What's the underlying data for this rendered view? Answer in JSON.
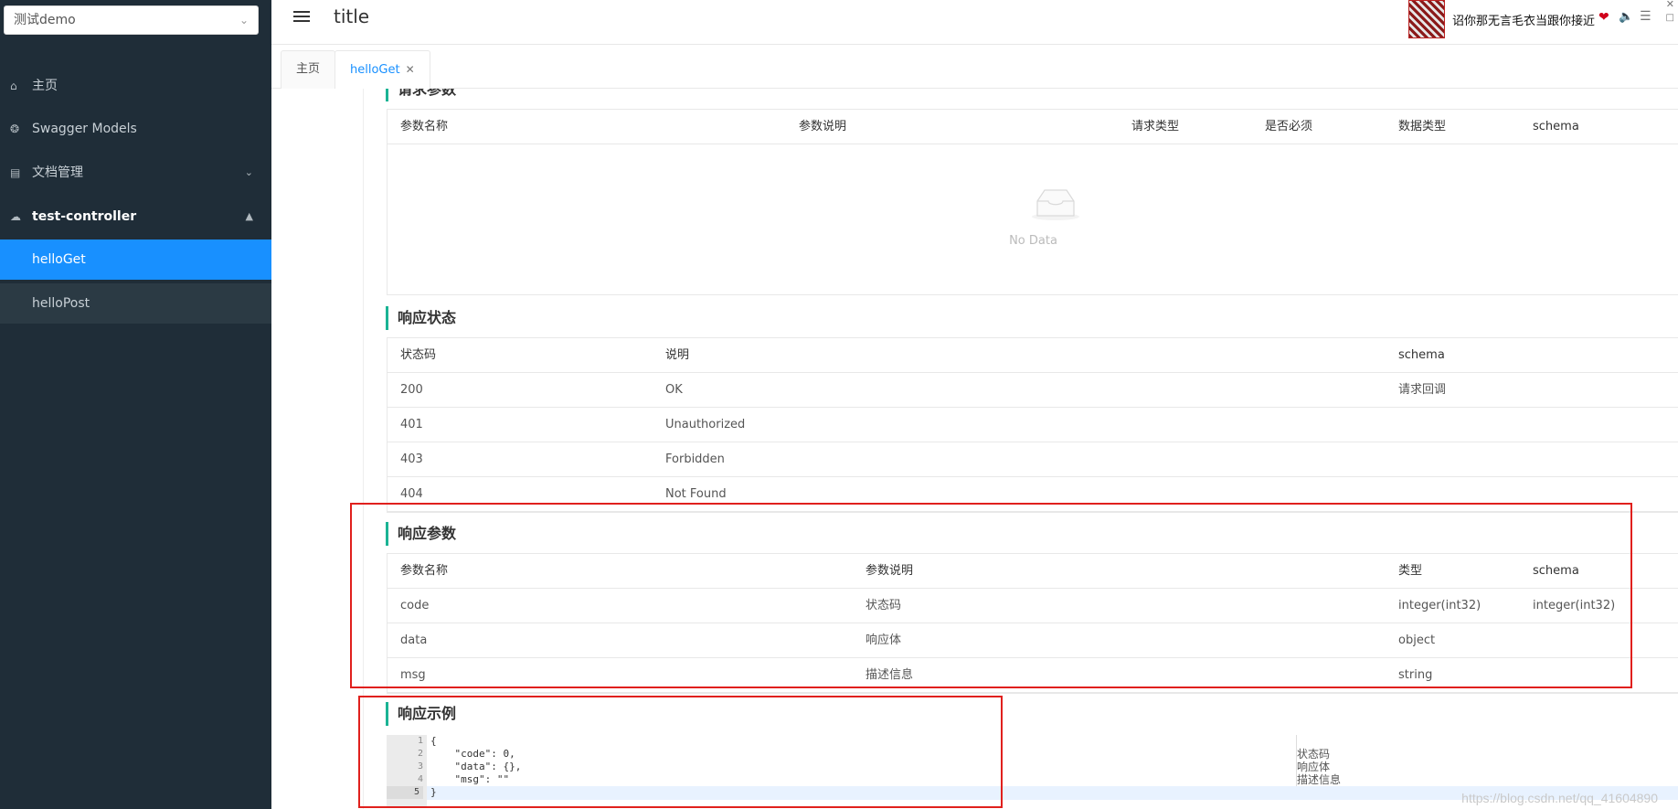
{
  "sidebar": {
    "project_select": "测试demo",
    "items": [
      {
        "label": "主页",
        "icon": "home-icon"
      },
      {
        "label": "Swagger Models",
        "icon": "box-icon"
      },
      {
        "label": "文档管理",
        "icon": "document-icon"
      },
      {
        "label": "test-controller",
        "icon": "cloud-icon"
      },
      {
        "label": "helloGet"
      },
      {
        "label": "helloPost"
      }
    ]
  },
  "header": {
    "title": "title",
    "music_title": "诏你那无言毛衣当跟你接近"
  },
  "tabs": [
    {
      "label": "主页"
    },
    {
      "label": "helloGet"
    }
  ],
  "request_params": {
    "section_title": "请求参数",
    "headers": [
      "参数名称",
      "参数说明",
      "请求类型",
      "是否必须",
      "数据类型",
      "schema"
    ],
    "empty_text": "No Data"
  },
  "response_status": {
    "section_title": "响应状态",
    "headers": [
      "状态码",
      "说明",
      "schema"
    ],
    "rows": [
      [
        "200",
        "OK",
        "请求回调"
      ],
      [
        "401",
        "Unauthorized",
        ""
      ],
      [
        "403",
        "Forbidden",
        ""
      ],
      [
        "404",
        "Not Found",
        ""
      ]
    ]
  },
  "response_params": {
    "section_title": "响应参数",
    "headers": [
      "参数名称",
      "参数说明",
      "类型",
      "schema"
    ],
    "rows": [
      [
        "code",
        "状态码",
        "integer(int32)",
        "integer(int32)"
      ],
      [
        "data",
        "响应体",
        "object",
        ""
      ],
      [
        "msg",
        "描述信息",
        "string",
        ""
      ]
    ]
  },
  "response_example": {
    "section_title": "响应示例",
    "line_numbers": [
      "1",
      "2",
      "3",
      "4",
      "5"
    ],
    "lines": [
      "{",
      "    \"code\": 0,",
      "    \"data\": {},",
      "    \"msg\": \"\"",
      "}"
    ],
    "comments": [
      "状态码",
      "响应体",
      "描述信息"
    ]
  },
  "watermark": "https://blog.csdn.net/qq_41604890",
  "colors": {
    "sidebar_bg": "#1f2d38",
    "accent": "#1890ff",
    "section_bar": "#1ab394",
    "annotation": "#e0201d"
  }
}
